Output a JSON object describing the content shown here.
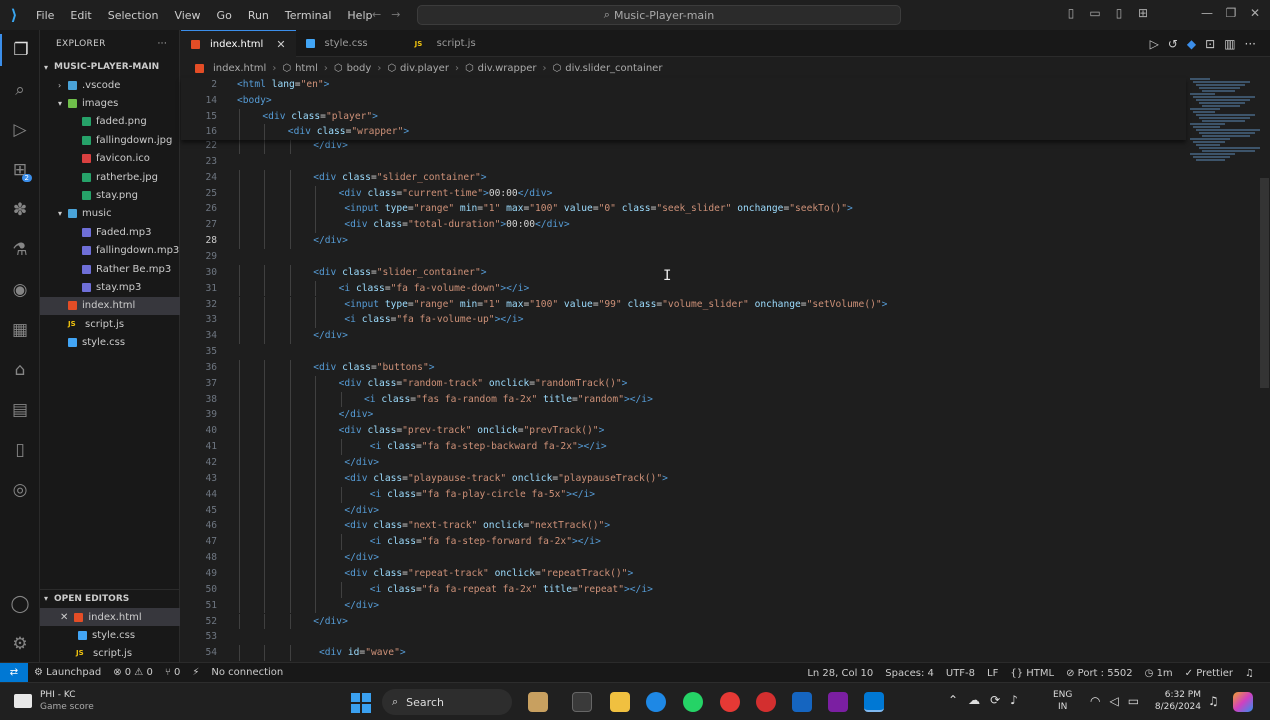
{
  "window": {
    "search": "Music-Player-main",
    "menu": [
      "File",
      "Edit",
      "Selection",
      "View",
      "Go",
      "Run",
      "Terminal",
      "Help"
    ]
  },
  "activity": {
    "extensions_badge": "2"
  },
  "explorer": {
    "title": "EXPLORER",
    "root": "MUSIC-PLAYER-MAIN",
    "items": [
      {
        "label": ".vscode",
        "kind": "folder"
      },
      {
        "label": "images",
        "kind": "folderg"
      },
      {
        "label": "faded.png",
        "kind": "png"
      },
      {
        "label": "fallingdown.jpg",
        "kind": "png"
      },
      {
        "label": "favicon.ico",
        "kind": "fav"
      },
      {
        "label": "ratherbe.jpg",
        "kind": "png"
      },
      {
        "label": "stay.png",
        "kind": "png"
      },
      {
        "label": "music",
        "kind": "folder"
      },
      {
        "label": "Faded.mp3",
        "kind": "mp3"
      },
      {
        "label": "fallingdown.mp3",
        "kind": "mp3"
      },
      {
        "label": "Rather Be.mp3",
        "kind": "mp3"
      },
      {
        "label": "stay.mp3",
        "kind": "mp3"
      },
      {
        "label": "index.html",
        "kind": "html"
      },
      {
        "label": "script.js",
        "kind": "js"
      },
      {
        "label": "style.css",
        "kind": "css"
      }
    ],
    "open_editors_title": "OPEN EDITORS",
    "open_editors": [
      "index.html",
      "style.css",
      "script.js"
    ]
  },
  "tabs": [
    {
      "label": "index.html",
      "icon": "html"
    },
    {
      "label": "style.css",
      "icon": "css"
    },
    {
      "label": "script.js",
      "icon": "js"
    }
  ],
  "breadcrumb": [
    "index.html",
    "html",
    "body",
    "div.player",
    "div.wrapper",
    "div.slider_container"
  ],
  "sticky": [
    {
      "n": "2",
      "indent": 0,
      "html": "<span class='tg'>&lt;html</span> <span class='at'>lang</span>=<span class='st'>\"en\"</span><span class='tg'>&gt;</span>"
    },
    {
      "n": "14",
      "indent": 0,
      "html": "<span class='tg'>&lt;body&gt;</span>"
    },
    {
      "n": "15",
      "indent": 1,
      "html": "<span class='tg'>&lt;div</span> <span class='at'>class</span>=<span class='st'>\"player\"</span><span class='tg'>&gt;</span>"
    },
    {
      "n": "16",
      "indent": 2,
      "html": "<span class='tg'>&lt;div</span> <span class='at'>class</span>=<span class='st'>\"wrapper\"</span><span class='tg'>&gt;</span>"
    }
  ],
  "code": [
    {
      "n": "22",
      "indent": 3,
      "html": "<span class='tg'>&lt;/div&gt;</span>"
    },
    {
      "n": "23",
      "indent": 0,
      "html": ""
    },
    {
      "n": "24",
      "indent": 3,
      "html": "<span class='tg'>&lt;div</span> <span class='at'>class</span>=<span class='st'>\"slider_container\"</span><span class='tg'>&gt;</span>"
    },
    {
      "n": "25",
      "indent": 4,
      "html": "<span class='tg'>&lt;div</span> <span class='at'>class</span>=<span class='st'>\"current-time\"</span><span class='tg'>&gt;</span><span class='tx'>00:00</span><span class='tg'>&lt;/div&gt;</span>"
    },
    {
      "n": "26",
      "indent": 4,
      "html": " <span class='tg'>&lt;input</span> <span class='at'>type</span>=<span class='st'>\"range\"</span> <span class='at'>min</span>=<span class='st'>\"1\"</span> <span class='at'>max</span>=<span class='st'>\"100\"</span> <span class='at'>value</span>=<span class='st'>\"0\"</span> <span class='at'>class</span>=<span class='st'>\"seek_slider\"</span> <span class='at'>onchange</span>=<span class='st'>\"seekTo()\"</span><span class='tg'>&gt;</span>"
    },
    {
      "n": "27",
      "indent": 4,
      "html": " <span class='tg'>&lt;div</span> <span class='at'>class</span>=<span class='st'>\"total-duration\"</span><span class='tg'>&gt;</span><span class='tx'>00:00</span><span class='tg'>&lt;/div&gt;</span>"
    },
    {
      "n": "28",
      "indent": 3,
      "html": "<span class='tg'>&lt;/div&gt;</span>",
      "cur": true
    },
    {
      "n": "29",
      "indent": 0,
      "html": ""
    },
    {
      "n": "30",
      "indent": 3,
      "html": "<span class='tg'>&lt;div</span> <span class='at'>class</span>=<span class='st'>\"slider_container\"</span><span class='tg'>&gt;</span>"
    },
    {
      "n": "31",
      "indent": 4,
      "html": "<span class='tg'>&lt;i</span> <span class='at'>class</span>=<span class='st'>\"fa fa-volume-down\"</span><span class='tg'>&gt;&lt;/i&gt;</span>"
    },
    {
      "n": "32",
      "indent": 4,
      "html": " <span class='tg'>&lt;input</span> <span class='at'>type</span>=<span class='st'>\"range\"</span> <span class='at'>min</span>=<span class='st'>\"1\"</span> <span class='at'>max</span>=<span class='st'>\"100\"</span> <span class='at'>value</span>=<span class='st'>\"99\"</span> <span class='at'>class</span>=<span class='st'>\"volume_slider\"</span> <span class='at'>onchange</span>=<span class='st'>\"setVolume()\"</span><span class='tg'>&gt;</span>"
    },
    {
      "n": "33",
      "indent": 4,
      "html": " <span class='tg'>&lt;i</span> <span class='at'>class</span>=<span class='st'>\"fa fa-volume-up\"</span><span class='tg'>&gt;&lt;/i&gt;</span>"
    },
    {
      "n": "34",
      "indent": 3,
      "html": "<span class='tg'>&lt;/div&gt;</span>"
    },
    {
      "n": "35",
      "indent": 0,
      "html": ""
    },
    {
      "n": "36",
      "indent": 3,
      "html": "<span class='tg'>&lt;div</span> <span class='at'>class</span>=<span class='st'>\"buttons\"</span><span class='tg'>&gt;</span>"
    },
    {
      "n": "37",
      "indent": 4,
      "html": "<span class='tg'>&lt;div</span> <span class='at'>class</span>=<span class='st'>\"random-track\"</span> <span class='at'>onclick</span>=<span class='st'>\"randomTrack()\"</span><span class='tg'>&gt;</span>"
    },
    {
      "n": "38",
      "indent": 5,
      "html": "<span class='tg'>&lt;i</span> <span class='at'>class</span>=<span class='st'>\"fas fa-random fa-2x\"</span> <span class='at'>title</span>=<span class='st'>\"random\"</span><span class='tg'>&gt;&lt;/i&gt;</span>"
    },
    {
      "n": "39",
      "indent": 4,
      "html": "<span class='tg'>&lt;/div&gt;</span>"
    },
    {
      "n": "40",
      "indent": 4,
      "html": "<span class='tg'>&lt;div</span> <span class='at'>class</span>=<span class='st'>\"prev-track\"</span> <span class='at'>onclick</span>=<span class='st'>\"prevTrack()\"</span><span class='tg'>&gt;</span>"
    },
    {
      "n": "41",
      "indent": 5,
      "html": " <span class='tg'>&lt;i</span> <span class='at'>class</span>=<span class='st'>\"fa fa-step-backward fa-2x\"</span><span class='tg'>&gt;&lt;/i&gt;</span>"
    },
    {
      "n": "42",
      "indent": 4,
      "html": " <span class='tg'>&lt;/div&gt;</span>"
    },
    {
      "n": "43",
      "indent": 4,
      "html": " <span class='tg'>&lt;div</span> <span class='at'>class</span>=<span class='st'>\"playpause-track\"</span> <span class='at'>onclick</span>=<span class='st'>\"playpauseTrack()\"</span><span class='tg'>&gt;</span>"
    },
    {
      "n": "44",
      "indent": 5,
      "html": " <span class='tg'>&lt;i</span> <span class='at'>class</span>=<span class='st'>\"fa fa-play-circle fa-5x\"</span><span class='tg'>&gt;&lt;/i&gt;</span>"
    },
    {
      "n": "45",
      "indent": 4,
      "html": " <span class='tg'>&lt;/div&gt;</span>"
    },
    {
      "n": "46",
      "indent": 4,
      "html": " <span class='tg'>&lt;div</span> <span class='at'>class</span>=<span class='st'>\"next-track\"</span> <span class='at'>onclick</span>=<span class='st'>\"nextTrack()\"</span><span class='tg'>&gt;</span>"
    },
    {
      "n": "47",
      "indent": 5,
      "html": " <span class='tg'>&lt;i</span> <span class='at'>class</span>=<span class='st'>\"fa fa-step-forward fa-2x\"</span><span class='tg'>&gt;&lt;/i&gt;</span>"
    },
    {
      "n": "48",
      "indent": 4,
      "html": " <span class='tg'>&lt;/div&gt;</span>"
    },
    {
      "n": "49",
      "indent": 4,
      "html": " <span class='tg'>&lt;div</span> <span class='at'>class</span>=<span class='st'>\"repeat-track\"</span> <span class='at'>onclick</span>=<span class='st'>\"repeatTrack()\"</span><span class='tg'>&gt;</span>"
    },
    {
      "n": "50",
      "indent": 5,
      "html": " <span class='tg'>&lt;i</span> <span class='at'>class</span>=<span class='st'>\"fa fa-repeat fa-2x\"</span> <span class='at'>title</span>=<span class='st'>\"repeat\"</span><span class='tg'>&gt;&lt;/i&gt;</span>"
    },
    {
      "n": "51",
      "indent": 4,
      "html": " <span class='tg'>&lt;/div&gt;</span>"
    },
    {
      "n": "52",
      "indent": 3,
      "html": "<span class='tg'>&lt;/div&gt;</span>"
    },
    {
      "n": "53",
      "indent": 0,
      "html": ""
    },
    {
      "n": "54",
      "indent": 3,
      "html": " <span class='tg'>&lt;div</span> <span class='at'>id</span>=<span class='st'>\"wave\"</span><span class='tg'>&gt;</span>"
    }
  ],
  "status": {
    "remote": "⇄",
    "launchpad": "Launchpad",
    "problems": "⊗ 0 ⚠ 0",
    "ports": "⑂ 0",
    "connection": "No connection",
    "position": "Ln 28, Col 10",
    "spaces": "Spaces: 4",
    "encoding": "UTF-8",
    "eol": "LF",
    "language": "HTML",
    "port": "Port : 5502",
    "time": "1m",
    "prettier": "Prettier"
  },
  "taskbar": {
    "weather_line1": "PHI - KC",
    "weather_line2": "Game score",
    "search": "Search",
    "lang1": "ENG",
    "lang2": "IN",
    "time": "6:32 PM",
    "date": "8/26/2024"
  },
  "colors": {
    "accent": "#0078d4",
    "tag": "#569cd6",
    "attr": "#9cdcfe",
    "string": "#ce9178"
  }
}
